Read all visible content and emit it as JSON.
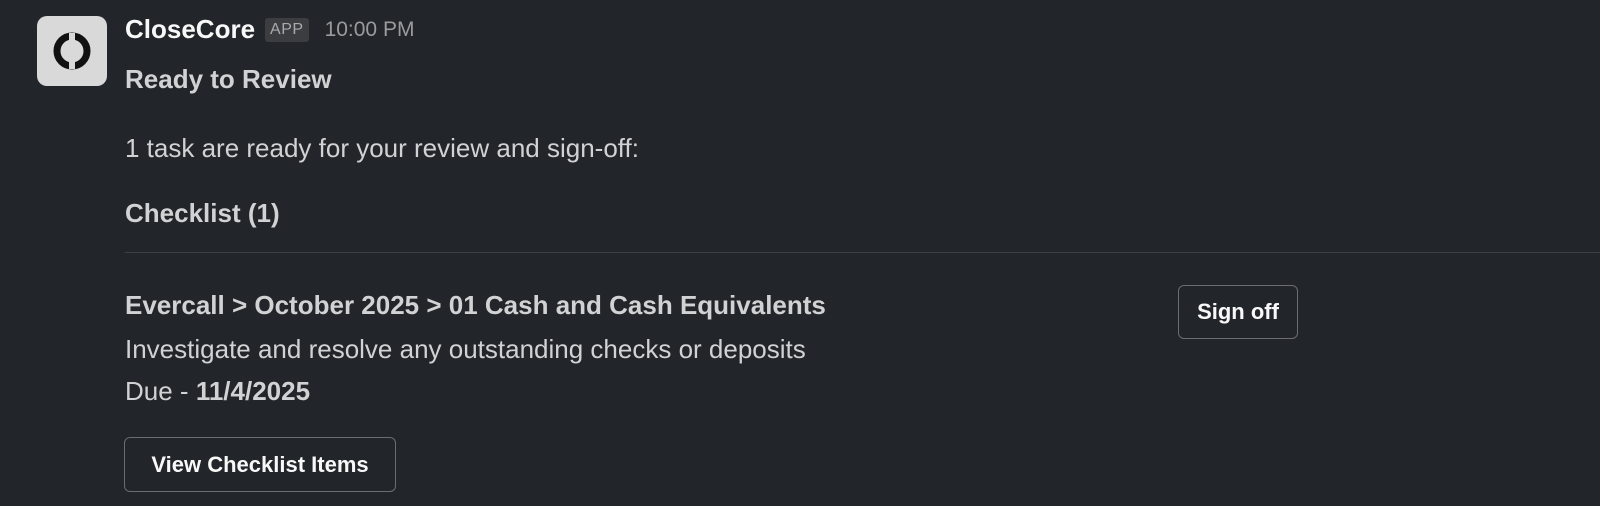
{
  "message": {
    "sender": "CloseCore",
    "badge": "APP",
    "timestamp": "10:00 PM",
    "title": "Ready to Review",
    "intro": "1 task are ready for your review and sign-off:",
    "section_heading": "Checklist (1)"
  },
  "task": {
    "path": "Evercall > October 2025 > 01 Cash and Cash Equivalents",
    "description": "Investigate and resolve any outstanding checks or deposits",
    "due_label": "Due - ",
    "due_date": "11/4/2025",
    "signoff_label": "Sign off"
  },
  "actions": {
    "view_checklist_label": "View Checklist Items"
  },
  "avatar": {
    "icon": "closecore-logo-icon",
    "background": "#d9d9d9"
  },
  "colors": {
    "background": "#222529",
    "text": "#d1d2d3",
    "muted": "#9a9b9d"
  }
}
